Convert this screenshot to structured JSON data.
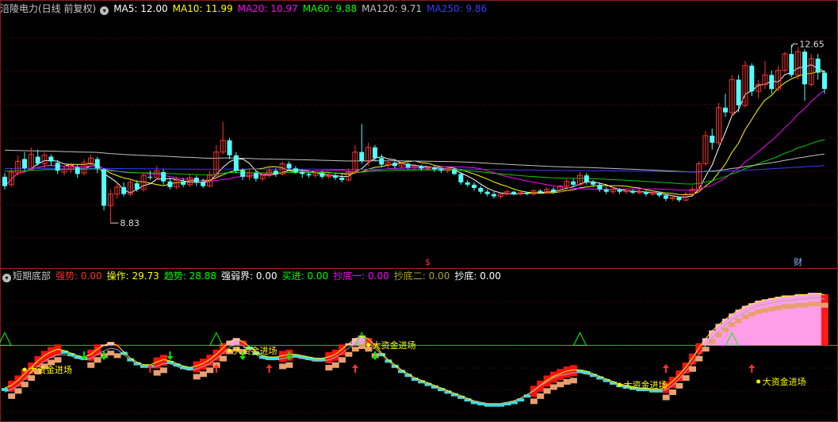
{
  "main_panel": {
    "title": "涪陵电力(日线 前复权)",
    "ma": [
      {
        "label": "MA5: 12.00",
        "color": "#ffffff"
      },
      {
        "label": "MA10: 11.99",
        "color": "#ffff00"
      },
      {
        "label": "MA20: 10.97",
        "color": "#ff00ff"
      },
      {
        "label": "MA60: 9.88",
        "color": "#00ff00"
      },
      {
        "label": "MA120: 9.71",
        "color": "#c0c0c0"
      },
      {
        "label": "MA250: 9.86",
        "color": "#3b3bff"
      }
    ],
    "high_label": "12.65",
    "low_label": "8.83",
    "marker_s": "$",
    "marker_cai": "财"
  },
  "sub_panel": {
    "title": "短期底部",
    "fields": [
      {
        "label": "强势: 0.00",
        "color": "#ff3030"
      },
      {
        "label": "操作: 29.73",
        "color": "#ffff00"
      },
      {
        "label": "趋势: 28.88",
        "color": "#00ff00"
      },
      {
        "label": "强弱界: 0.00",
        "color": "#ffffff"
      },
      {
        "label": "买进: 0.00",
        "color": "#00ff00"
      },
      {
        "label": "抄底一: 0.00",
        "color": "#ff00ff"
      },
      {
        "label": "抄底二: 0.00",
        "color": "#b0a040"
      },
      {
        "label": "抄底: 0.00",
        "color": "#ffffff"
      }
    ],
    "annotation_text": "大资金进场"
  },
  "chart_data": [
    {
      "type": "candlestick",
      "title": "涪陵电力(日线 前复权)",
      "ylim": [
        8.0,
        13.3
      ],
      "high": 12.65,
      "low": 8.83,
      "grid": true,
      "candles": [
        [
          9.82,
          9.62,
          9.9,
          9.55
        ],
        [
          9.65,
          9.92,
          10.0,
          9.6
        ],
        [
          9.9,
          10.15,
          10.28,
          9.85
        ],
        [
          10.2,
          10.0,
          10.35,
          9.95
        ],
        [
          9.98,
          10.3,
          10.45,
          9.95
        ],
        [
          10.25,
          10.1,
          10.4,
          10.05
        ],
        [
          10.1,
          10.28,
          10.35,
          10.0
        ],
        [
          10.25,
          10.15,
          10.3,
          10.05
        ],
        [
          10.12,
          9.95,
          10.18,
          9.88
        ],
        [
          9.92,
          9.98,
          10.05,
          9.85
        ],
        [
          9.98,
          10.05,
          10.12,
          9.9
        ],
        [
          10.02,
          9.88,
          10.08,
          9.8
        ],
        [
          9.9,
          10.12,
          10.2,
          9.85
        ],
        [
          10.12,
          10.22,
          10.3,
          10.05
        ],
        [
          10.2,
          10.0,
          10.25,
          9.9
        ],
        [
          9.98,
          9.2,
          10.0,
          9.1
        ],
        [
          9.2,
          9.45,
          9.55,
          8.83
        ],
        [
          9.45,
          9.6,
          9.7,
          9.35
        ],
        [
          9.6,
          9.45,
          9.7,
          9.4
        ],
        [
          9.45,
          9.7,
          9.78,
          9.4
        ],
        [
          9.68,
          9.55,
          9.75,
          9.5
        ],
        [
          9.55,
          9.85,
          9.9,
          9.5
        ],
        [
          9.82,
          9.8,
          9.95,
          9.75
        ],
        [
          9.8,
          9.95,
          10.05,
          9.75
        ],
        [
          9.92,
          9.72,
          9.98,
          9.65
        ],
        [
          9.72,
          9.6,
          9.8,
          9.55
        ],
        [
          9.6,
          9.75,
          9.82,
          9.55
        ],
        [
          9.72,
          9.65,
          9.8,
          9.6
        ],
        [
          9.65,
          9.8,
          9.88,
          9.6
        ],
        [
          9.8,
          9.7,
          9.85,
          9.62
        ],
        [
          9.7,
          9.62,
          9.78,
          9.58
        ],
        [
          9.62,
          9.85,
          9.95,
          9.6
        ],
        [
          9.85,
          10.35,
          10.5,
          9.8
        ],
        [
          10.35,
          10.6,
          11.0,
          10.3
        ],
        [
          10.6,
          10.28,
          10.65,
          10.2
        ],
        [
          10.28,
          9.95,
          10.35,
          9.9
        ],
        [
          9.95,
          9.82,
          10.0,
          9.75
        ],
        [
          9.82,
          9.9,
          9.98,
          9.75
        ],
        [
          9.9,
          9.78,
          9.95,
          9.72
        ],
        [
          9.78,
          9.85,
          9.92,
          9.72
        ],
        [
          9.85,
          9.95,
          10.02,
          9.8
        ],
        [
          9.95,
          9.88,
          10.0,
          9.82
        ],
        [
          9.88,
          10.1,
          10.15,
          9.85
        ],
        [
          10.1,
          10.0,
          10.15,
          9.95
        ],
        [
          10.0,
          9.92,
          10.05,
          9.88
        ],
        [
          9.92,
          9.88,
          9.98,
          9.8
        ],
        [
          9.88,
          9.85,
          9.92,
          9.8
        ],
        [
          9.85,
          9.9,
          9.95,
          9.8
        ],
        [
          9.9,
          9.82,
          9.95,
          9.78
        ],
        [
          9.82,
          9.85,
          9.9,
          9.78
        ],
        [
          9.85,
          9.8,
          9.9,
          9.75
        ],
        [
          9.8,
          9.75,
          9.88,
          9.7
        ],
        [
          9.75,
          9.92,
          10.0,
          9.72
        ],
        [
          9.92,
          10.35,
          10.5,
          9.88
        ],
        [
          10.35,
          10.15,
          10.95,
          10.1
        ],
        [
          10.15,
          10.45,
          10.55,
          10.05
        ],
        [
          10.45,
          10.22,
          10.5,
          10.15
        ],
        [
          10.22,
          10.08,
          10.3,
          10.02
        ],
        [
          10.08,
          10.12,
          10.18,
          10.0
        ],
        [
          10.12,
          10.05,
          10.15,
          10.0
        ],
        [
          10.05,
          10.1,
          10.15,
          10.0
        ],
        [
          10.1,
          10.02,
          10.12,
          9.98
        ],
        [
          10.02,
          10.05,
          10.1,
          9.98
        ],
        [
          10.05,
          10.0,
          10.08,
          9.95
        ],
        [
          10.0,
          10.02,
          10.05,
          9.95
        ],
        [
          10.02,
          9.98,
          10.05,
          9.92
        ],
        [
          9.98,
          9.95,
          10.02,
          9.9
        ],
        [
          9.95,
          10.0,
          10.05,
          9.9
        ],
        [
          9.98,
          9.88,
          10.0,
          9.85
        ],
        [
          9.88,
          9.7,
          9.9,
          9.65
        ],
        [
          9.7,
          9.65,
          9.75,
          9.6
        ],
        [
          9.65,
          9.58,
          9.7,
          9.52
        ],
        [
          9.58,
          9.5,
          9.62,
          9.45
        ],
        [
          9.5,
          9.45,
          9.55,
          9.4
        ],
        [
          9.45,
          9.4,
          9.5,
          9.35
        ],
        [
          9.4,
          9.45,
          9.5,
          9.35
        ],
        [
          9.45,
          9.5,
          9.55,
          9.42
        ],
        [
          9.5,
          9.45,
          9.52,
          9.42
        ],
        [
          9.45,
          9.48,
          9.5,
          9.42
        ],
        [
          9.48,
          9.45,
          9.5,
          9.42
        ],
        [
          9.45,
          9.52,
          9.55,
          9.42
        ],
        [
          9.52,
          9.48,
          9.55,
          9.45
        ],
        [
          9.48,
          9.55,
          9.6,
          9.45
        ],
        [
          9.55,
          9.5,
          9.6,
          9.45
        ],
        [
          9.5,
          9.62,
          9.65,
          9.48
        ],
        [
          9.62,
          9.72,
          9.78,
          9.58
        ],
        [
          9.72,
          9.65,
          9.78,
          9.6
        ],
        [
          9.65,
          9.85,
          9.92,
          9.62
        ],
        [
          9.85,
          9.7,
          9.9,
          9.65
        ],
        [
          9.7,
          9.65,
          9.75,
          9.6
        ],
        [
          9.65,
          9.55,
          9.7,
          9.5
        ],
        [
          9.55,
          9.5,
          9.6,
          9.45
        ],
        [
          9.5,
          9.55,
          9.6,
          9.45
        ],
        [
          9.55,
          9.5,
          9.58,
          9.45
        ],
        [
          9.5,
          9.52,
          9.55,
          9.45
        ],
        [
          9.52,
          9.48,
          9.55,
          9.45
        ],
        [
          9.48,
          9.5,
          9.55,
          9.45
        ],
        [
          9.5,
          9.45,
          9.52,
          9.4
        ],
        [
          9.45,
          9.48,
          9.5,
          9.4
        ],
        [
          9.48,
          9.42,
          9.5,
          9.38
        ],
        [
          9.42,
          9.35,
          9.45,
          9.3
        ],
        [
          9.35,
          9.38,
          9.42,
          9.3
        ],
        [
          9.38,
          9.32,
          9.4,
          9.28
        ],
        [
          9.32,
          9.45,
          9.5,
          9.3
        ],
        [
          9.45,
          9.55,
          9.62,
          9.42
        ],
        [
          9.55,
          10.1,
          10.15,
          9.5
        ],
        [
          10.1,
          10.7,
          10.8,
          10.05
        ],
        [
          10.7,
          10.55,
          10.85,
          10.4
        ],
        [
          10.55,
          11.3,
          11.4,
          10.5
        ],
        [
          11.3,
          11.2,
          11.6,
          11.1
        ],
        [
          11.2,
          11.9,
          12.0,
          11.1
        ],
        [
          11.9,
          11.35,
          12.0,
          11.2
        ],
        [
          11.35,
          12.2,
          12.3,
          11.3
        ],
        [
          12.2,
          11.65,
          12.25,
          11.55
        ],
        [
          11.65,
          11.8,
          11.9,
          11.5
        ],
        [
          11.8,
          12.0,
          12.3,
          11.7
        ],
        [
          12.0,
          11.7,
          12.1,
          11.6
        ],
        [
          11.7,
          12.1,
          12.2,
          11.65
        ],
        [
          12.1,
          12.45,
          12.5,
          12.05
        ],
        [
          12.45,
          12.0,
          12.65,
          11.95
        ],
        [
          12.0,
          12.5,
          12.6,
          11.9
        ],
        [
          12.5,
          11.8,
          12.55,
          11.45
        ],
        [
          11.8,
          12.35,
          12.45,
          11.75
        ],
        [
          12.35,
          12.05,
          12.45,
          11.9
        ],
        [
          12.05,
          11.7,
          12.1,
          11.6
        ]
      ]
    },
    {
      "type": "area",
      "title": "短期底部",
      "ylim": [
        0,
        100
      ],
      "series": [
        {
          "name": "操作",
          "values": [
            22,
            24,
            28,
            33,
            38,
            43,
            47,
            50,
            52,
            51,
            49,
            47,
            46,
            48,
            52,
            55,
            57,
            55,
            50,
            45,
            42,
            40,
            40,
            42,
            44,
            43,
            41,
            39,
            38,
            39,
            41,
            44,
            48,
            53,
            58,
            60,
            58,
            54,
            50,
            47,
            46,
            46,
            47,
            48,
            48,
            47,
            46,
            45,
            45,
            46,
            48,
            52,
            56,
            60,
            62,
            60,
            55,
            49,
            44,
            40,
            36,
            33,
            30,
            28,
            26,
            24,
            22,
            20,
            18,
            16,
            14,
            12,
            11,
            10,
            10,
            10,
            11,
            12,
            14,
            17,
            20,
            24,
            28,
            31,
            33,
            35,
            36,
            36,
            35,
            33,
            31,
            29,
            27,
            25,
            24,
            23,
            22,
            22,
            21,
            21,
            23,
            27,
            32,
            38,
            45,
            53,
            60,
            66,
            71,
            75,
            79,
            82,
            85,
            87,
            89,
            90,
            91,
            92,
            93,
            93,
            94,
            94,
            95,
            95,
            94
          ]
        },
        {
          "name": "趋势",
          "values": [
            20,
            22,
            25,
            30,
            35,
            40,
            44,
            47,
            49,
            49,
            48,
            46,
            45,
            46,
            49,
            52,
            54,
            53,
            49,
            45,
            42,
            40,
            39,
            40,
            42,
            42,
            40,
            38,
            37,
            38,
            40,
            42,
            46,
            50,
            55,
            57,
            56,
            53,
            49,
            46,
            45,
            45,
            46,
            47,
            47,
            46,
            45,
            44,
            44,
            45,
            47,
            50,
            54,
            57,
            59,
            58,
            54,
            49,
            44,
            40,
            36,
            33,
            30,
            28,
            26,
            24,
            22,
            20,
            18,
            16,
            14,
            13,
            12,
            11,
            11,
            11,
            12,
            13,
            15,
            18,
            21,
            25,
            28,
            31,
            33,
            34,
            35,
            35,
            34,
            33,
            31,
            29,
            27,
            25,
            24,
            23,
            22,
            22,
            21,
            21,
            22,
            25,
            30,
            36,
            42,
            49,
            56,
            62,
            67,
            72,
            76,
            79,
            82,
            85,
            87,
            88,
            89,
            90,
            91,
            91,
            92,
            92,
            93,
            93,
            92
          ]
        }
      ],
      "baseline": 55
    }
  ]
}
